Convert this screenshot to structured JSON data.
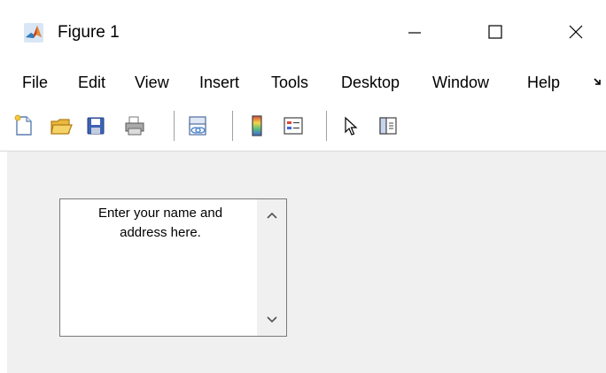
{
  "window": {
    "title": "Figure 1",
    "icons": {
      "app": "matlab-icon",
      "minimize": "minimize-icon",
      "maximize": "maximize-icon",
      "close": "close-icon"
    }
  },
  "menubar": {
    "items": [
      "File",
      "Edit",
      "View",
      "Insert",
      "Tools",
      "Desktop",
      "Window",
      "Help"
    ],
    "overflow_icon": "chevron-more-icon"
  },
  "toolbar": {
    "buttons": [
      "new-figure-icon",
      "open-file-icon",
      "save-figure-icon",
      "print-figure-icon",
      "link-plot-icon",
      "insert-colorbar-icon",
      "insert-legend-icon",
      "edit-plot-icon",
      "open-property-inspector-icon"
    ]
  },
  "editbox": {
    "text_line1": "Enter your name and",
    "text_line2": "address here.",
    "scroll_up_icon": "scroll-up-icon",
    "scroll_down_icon": "scroll-down-icon"
  },
  "colors": {
    "client_background": "#f0f0f0",
    "window_background": "#ffffff",
    "border": "#7a7a7a"
  }
}
